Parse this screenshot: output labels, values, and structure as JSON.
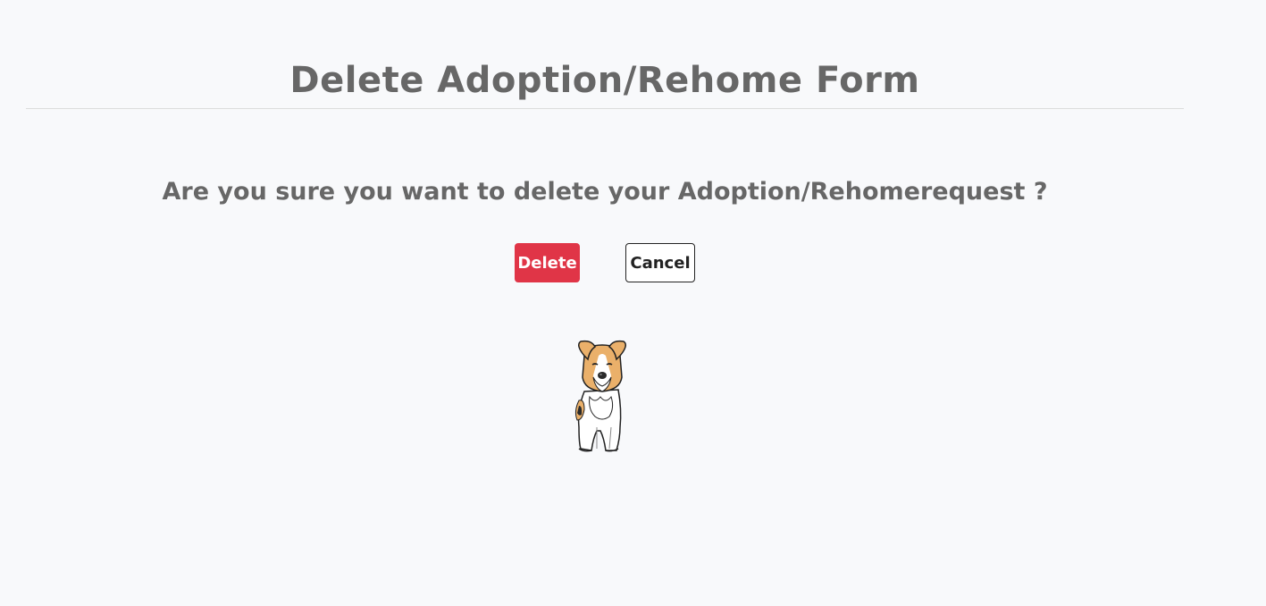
{
  "page": {
    "title": "Delete Adoption/Rehome Form",
    "question": "Are you sure you want to delete your Adoption/Rehomerequest ?"
  },
  "actions": {
    "delete_label": "Delete",
    "cancel_label": "Cancel"
  },
  "illustration": {
    "icon": "dog-illustration",
    "colors": {
      "fur_tan": "#eab06a",
      "fur_white": "#ffffff",
      "fur_black": "#2b2b2b",
      "outline": "#222222"
    }
  },
  "colors": {
    "background": "#f8f9fb",
    "text": "#676767",
    "delete_button": "#e03547",
    "cancel_border": "#222222"
  }
}
